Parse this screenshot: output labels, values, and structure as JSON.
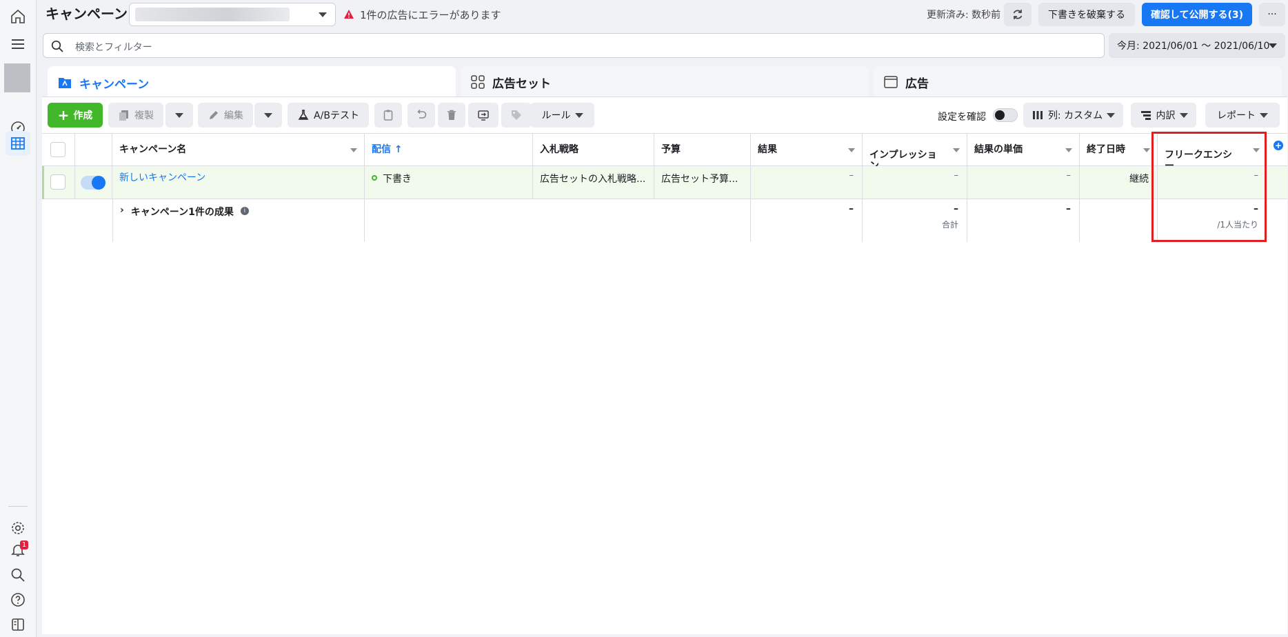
{
  "header": {
    "title": "キャンペーン",
    "error_text": "1件の広告にエラーがあります",
    "updated_label": "更新済み: 数秒前",
    "discard_label": "下書きを破棄する",
    "publish_label": "確認して公開する(3)",
    "more_label": "···"
  },
  "search": {
    "placeholder": "検索とフィルター"
  },
  "date_range": {
    "label": "今月: 2021/06/01 ～ 2021/06/10"
  },
  "tabs": [
    {
      "label": "キャンペーン",
      "active": true
    },
    {
      "label": "広告セット"
    },
    {
      "label": "広告"
    }
  ],
  "toolbar": {
    "create_label": "作成",
    "duplicate_label": "複製",
    "edit_label": "編集",
    "ab_test_label": "A/Bテスト",
    "rules_label": "ルール",
    "review_settings_label": "設定を確認",
    "columns_label": "列: カスタム",
    "breakdown_label": "内訳",
    "reports_label": "レポート"
  },
  "table": {
    "headers": {
      "name": "キャンペーン名",
      "delivery": "配信 ↑",
      "bid_strategy": "入札戦略",
      "budget": "予算",
      "results": "結果",
      "impressions": "インプレッショ\nン",
      "cost_per_result": "結果の単価",
      "end_date": "終了日時",
      "frequency": "フリークエンシ\nー"
    },
    "rows": [
      {
        "name": "新しいキャンペーン",
        "delivery": "下書き",
        "bid_strategy": "広告セットの入札戦略...",
        "budget": "広告セット予算...",
        "results": "–",
        "impressions": "–",
        "cost_per_result": "–",
        "end_date": "継続",
        "frequency": "–"
      }
    ],
    "summary": {
      "label": "キャンペーン1件の成果",
      "results": "–",
      "impressions": "–",
      "impressions_note": "合計",
      "cost_per_result": "–",
      "frequency": "–",
      "frequency_note": "/1人当たり"
    }
  },
  "colors": {
    "primary": "#1877f2",
    "create": "#42b72a",
    "highlight": "#e02020",
    "draft_dot": "#42b72a"
  }
}
